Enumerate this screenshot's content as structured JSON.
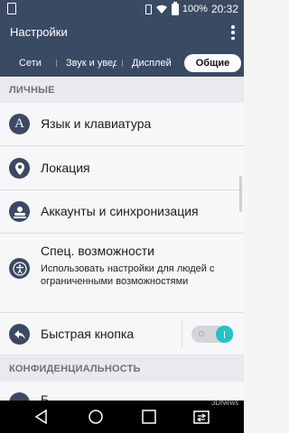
{
  "status_bar": {
    "battery": "100%",
    "time": "20:32"
  },
  "app_bar": {
    "title": "Настройки",
    "menu_icon": "more-vert-icon"
  },
  "tabs": [
    {
      "label": "Сети",
      "active": false
    },
    {
      "label": "Звук и уведомления",
      "active": false
    },
    {
      "label": "Дисплей",
      "active": false
    },
    {
      "label": "Общие",
      "active": true
    }
  ],
  "sections": {
    "personal": "ЛИЧНЫЕ",
    "privacy": "КОНФИДЕНЦИАЛЬНОСТЬ"
  },
  "items": {
    "language": {
      "label": "Язык и клавиатура",
      "icon": "language-icon"
    },
    "location": {
      "label": "Локация",
      "icon": "location-pin-icon"
    },
    "accounts": {
      "label": "Аккаунты и синхронизация",
      "icon": "accounts-icon"
    },
    "accessibility": {
      "label": "Спец. возможности",
      "description": "Использовать настройки для людей с ограниченными возможностями",
      "icon": "accessibility-icon"
    },
    "shortcut": {
      "label": "Быстрая кнопка",
      "icon": "shortcut-arrow-icon",
      "toggle_on": true
    },
    "partial": {
      "label": "Б"
    }
  },
  "colors": {
    "primary": "#3b4a63",
    "accent": "#22c2c8",
    "section_bg": "#e9e9ee"
  },
  "watermark": "3DNews"
}
